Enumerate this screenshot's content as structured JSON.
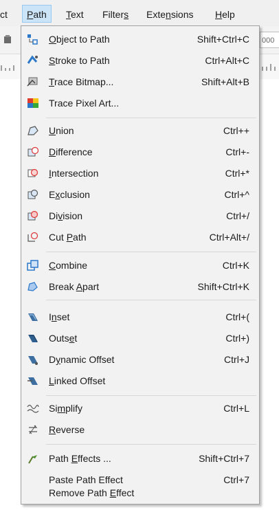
{
  "menubar": {
    "items": [
      {
        "label": "ct"
      },
      {
        "prefix": "",
        "u": "P",
        "suffix": "ath"
      },
      {
        "prefix": "",
        "u": "T",
        "suffix": "ext"
      },
      {
        "prefix": "Filter",
        "u": "s",
        "suffix": ""
      },
      {
        "prefix": "Exte",
        "u": "n",
        "suffix": "sions"
      },
      {
        "prefix": "",
        "u": "H",
        "suffix": "elp"
      }
    ]
  },
  "background": {
    "field_value": "000"
  },
  "menu": {
    "items": [
      {
        "icon": "object-to-path-icon",
        "pre": "",
        "u": "O",
        "post": "bject to Path",
        "shortcut": "Shift+Ctrl+C"
      },
      {
        "icon": "stroke-to-path-icon",
        "pre": "",
        "u": "S",
        "post": "troke to Path",
        "shortcut": "Ctrl+Alt+C"
      },
      {
        "icon": "trace-bitmap-icon",
        "pre": "",
        "u": "T",
        "post": "race Bitmap...",
        "shortcut": "Shift+Alt+B"
      },
      {
        "icon": "trace-pixel-art-icon",
        "pre": "Trace Pixel Art...",
        "u": "",
        "post": "",
        "shortcut": ""
      },
      {
        "icon": "union-icon",
        "pre": "",
        "u": "U",
        "post": "nion",
        "shortcut": "Ctrl++"
      },
      {
        "icon": "difference-icon",
        "pre": "",
        "u": "D",
        "post": "ifference",
        "shortcut": "Ctrl+-"
      },
      {
        "icon": "intersection-icon",
        "pre": "",
        "u": "I",
        "post": "ntersection",
        "shortcut": "Ctrl+*"
      },
      {
        "icon": "exclusion-icon",
        "pre": "E",
        "u": "x",
        "post": "clusion",
        "shortcut": "Ctrl+^"
      },
      {
        "icon": "division-icon",
        "pre": "Di",
        "u": "v",
        "post": "ision",
        "shortcut": "Ctrl+/"
      },
      {
        "icon": "cut-path-icon",
        "pre": "Cut ",
        "u": "P",
        "post": "ath",
        "shortcut": "Ctrl+Alt+/"
      },
      {
        "icon": "combine-icon",
        "pre": "",
        "u": "C",
        "post": "ombine",
        "shortcut": "Ctrl+K"
      },
      {
        "icon": "break-apart-icon",
        "pre": "Break ",
        "u": "A",
        "post": "part",
        "shortcut": "Shift+Ctrl+K"
      },
      {
        "icon": "inset-icon",
        "pre": "I",
        "u": "n",
        "post": "set",
        "shortcut": "Ctrl+("
      },
      {
        "icon": "outset-icon",
        "pre": "Outs",
        "u": "e",
        "post": "t",
        "shortcut": "Ctrl+)"
      },
      {
        "icon": "dynamic-offset-icon",
        "pre": "D",
        "u": "y",
        "post": "namic Offset",
        "shortcut": "Ctrl+J"
      },
      {
        "icon": "linked-offset-icon",
        "pre": "",
        "u": "L",
        "post": "inked Offset",
        "shortcut": ""
      },
      {
        "icon": "simplify-icon",
        "pre": "Si",
        "u": "m",
        "post": "plify",
        "shortcut": "Ctrl+L"
      },
      {
        "icon": "reverse-icon",
        "pre": "",
        "u": "R",
        "post": "everse",
        "shortcut": ""
      },
      {
        "icon": "path-effects-icon",
        "pre": "Path ",
        "u": "E",
        "post": "ffects ...",
        "shortcut": "Shift+Ctrl+7"
      },
      {
        "icon": "",
        "pre": "Paste Path Effect",
        "u": "",
        "post": "",
        "shortcut": "Ctrl+7"
      },
      {
        "icon": "",
        "pre": "Remove Path ",
        "u": "E",
        "post": "ffect",
        "shortcut": ""
      }
    ]
  },
  "colors": {
    "highlight": "#cce4f7",
    "icon_blue": "#2b78c9",
    "menu_bg": "#f2f2f2"
  }
}
